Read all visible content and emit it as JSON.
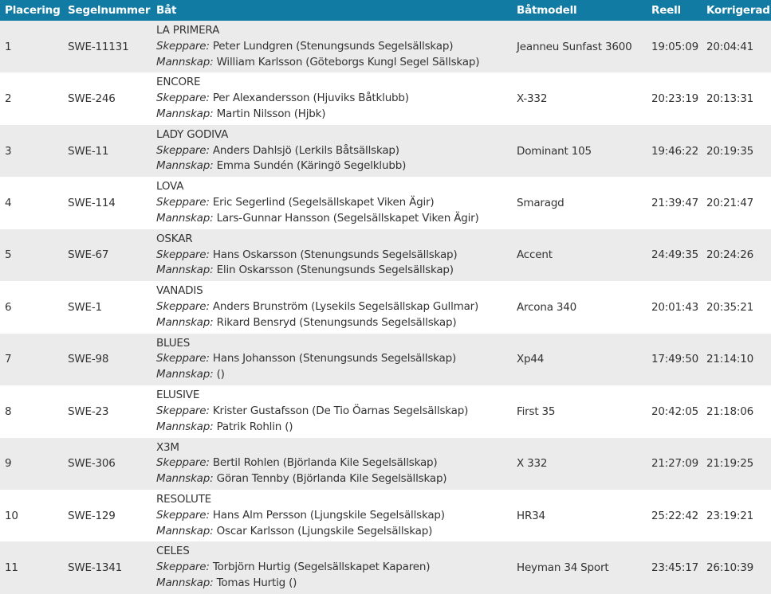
{
  "columns": {
    "placering": "Placering",
    "segelnummer": "Segelnummer",
    "bat": "Båt",
    "batmodell": "Båtmodell",
    "reell": "Reell",
    "korrigerad": "Korrigerad"
  },
  "roles": {
    "skeppare": "Skeppare:",
    "mannskap": "Mannskap:"
  },
  "rows": [
    {
      "place": "1",
      "sail": "SWE-11131",
      "name": "LA PRIMERA",
      "skipper": "Peter Lundgren (Stenungsunds Segelsällskap)",
      "crew": "William Karlsson (Göteborgs Kungl Segel Sällskap)",
      "model": "Jeanneu Sunfast 3600",
      "real": "19:05:09",
      "corrected": "20:04:41"
    },
    {
      "place": "2",
      "sail": "SWE-246",
      "name": "ENCORE",
      "skipper": "Per Alexandersson (Hjuviks Båtklubb)",
      "crew": "Martin Nilsson (Hjbk)",
      "model": "X-332",
      "real": "20:23:19",
      "corrected": "20:13:31"
    },
    {
      "place": "3",
      "sail": "SWE-11",
      "name": "LADY GODIVA",
      "skipper": "Anders Dahlsjö (Lerkils Båtsällskap)",
      "crew": "Emma Sundén (Käringö Segelklubb)",
      "model": "Dominant 105",
      "real": "19:46:22",
      "corrected": "20:19:35"
    },
    {
      "place": "4",
      "sail": "SWE-114",
      "name": "LOVA",
      "skipper": "Eric Segerlind (Segelsällskapet Viken Ägir)",
      "crew": "Lars-Gunnar Hansson (Segelsällskapet Viken Ägir)",
      "model": "Smaragd",
      "real": "21:39:47",
      "corrected": "20:21:47"
    },
    {
      "place": "5",
      "sail": "SWE-67",
      "name": "OSKAR",
      "skipper": "Hans Oskarsson (Stenungsunds Segelsällskap)",
      "crew": "Elin Oskarsson (Stenungsunds Segelsällskap)",
      "model": "Accent",
      "real": "24:49:35",
      "corrected": "20:24:26"
    },
    {
      "place": "6",
      "sail": "SWE-1",
      "name": "VANADIS",
      "skipper": "Anders Brunström (Lysekils Segelsällskap Gullmar)",
      "crew": "Rikard Bensryd (Stenungsunds Segelsällskap)",
      "model": "Arcona 340",
      "real": "20:01:43",
      "corrected": "20:35:21"
    },
    {
      "place": "7",
      "sail": "SWE-98",
      "name": "BLUES",
      "skipper": "Hans Johansson (Stenungsunds Segelsällskap)",
      "crew": "()",
      "model": "Xp44",
      "real": "17:49:50",
      "corrected": "21:14:10"
    },
    {
      "place": "8",
      "sail": "SWE-23",
      "name": "ELUSIVE",
      "skipper": "Krister Gustafsson (De Tio Öarnas Segelsällskap)",
      "crew": "Patrik Rohlin ()",
      "model": "First 35",
      "real": "20:42:05",
      "corrected": "21:18:06"
    },
    {
      "place": "9",
      "sail": "SWE-306",
      "name": "X3M",
      "skipper": "Bertil Rohlen (Björlanda Kile Segelsällskap)",
      "crew": "Göran Tennby (Björlanda Kile Segelsällskap)",
      "model": "X 332",
      "real": "21:27:09",
      "corrected": "21:19:25"
    },
    {
      "place": "10",
      "sail": "SWE-129",
      "name": "RESOLUTE",
      "skipper": "Hans Alm Persson (Ljungskile Segelsällskap)",
      "crew": "Oscar Karlsson (Ljungskile Segelsällskap)",
      "model": "HR34",
      "real": "25:22:42",
      "corrected": "23:19:21"
    },
    {
      "place": "11",
      "sail": "SWE-1341",
      "name": "CELES",
      "skipper": "Torbjörn Hurtig (Segelsällskapet Kaparen)",
      "crew": "Tomas Hurtig ()",
      "model": "Heyman 34 Sport",
      "real": "23:45:17",
      "corrected": "26:10:39"
    }
  ]
}
